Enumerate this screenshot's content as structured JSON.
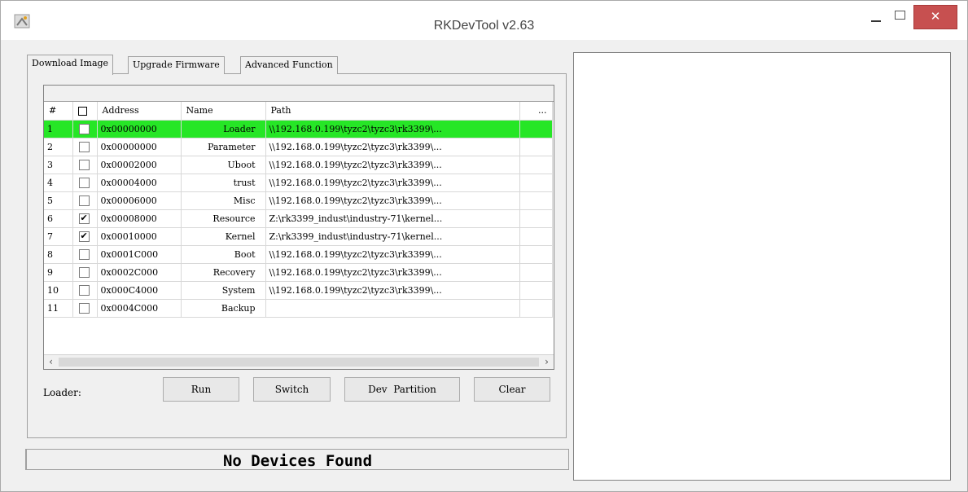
{
  "window": {
    "title": "RKDevTool v2.63"
  },
  "tabs": [
    {
      "label": "Download Image"
    },
    {
      "label": "Upgrade Firmware"
    },
    {
      "label": "Advanced Function"
    }
  ],
  "grid": {
    "headers": {
      "num": "#",
      "address": "Address",
      "name": "Name",
      "path": "Path",
      "more": "..."
    },
    "rows": [
      {
        "num": "1",
        "checked": false,
        "address": "0x00000000",
        "name": "Loader",
        "path": "\\\\192.168.0.199\\tyzc2\\tyzc3\\rk3399\\...",
        "selected": true
      },
      {
        "num": "2",
        "checked": false,
        "address": "0x00000000",
        "name": "Parameter",
        "path": "\\\\192.168.0.199\\tyzc2\\tyzc3\\rk3399\\..."
      },
      {
        "num": "3",
        "checked": false,
        "address": "0x00002000",
        "name": "Uboot",
        "path": "\\\\192.168.0.199\\tyzc2\\tyzc3\\rk3399\\..."
      },
      {
        "num": "4",
        "checked": false,
        "address": "0x00004000",
        "name": "trust",
        "path": "\\\\192.168.0.199\\tyzc2\\tyzc3\\rk3399\\..."
      },
      {
        "num": "5",
        "checked": false,
        "address": "0x00006000",
        "name": "Misc",
        "path": "\\\\192.168.0.199\\tyzc2\\tyzc3\\rk3399\\..."
      },
      {
        "num": "6",
        "checked": true,
        "address": "0x00008000",
        "name": "Resource",
        "path": "Z:\\rk3399_indust\\industry-71\\kernel..."
      },
      {
        "num": "7",
        "checked": true,
        "address": "0x00010000",
        "name": "Kernel",
        "path": "Z:\\rk3399_indust\\industry-71\\kernel..."
      },
      {
        "num": "8",
        "checked": false,
        "address": "0x0001C000",
        "name": "Boot",
        "path": "\\\\192.168.0.199\\tyzc2\\tyzc3\\rk3399\\..."
      },
      {
        "num": "9",
        "checked": false,
        "address": "0x0002C000",
        "name": "Recovery",
        "path": "\\\\192.168.0.199\\tyzc2\\tyzc3\\rk3399\\..."
      },
      {
        "num": "10",
        "checked": false,
        "address": "0x000C4000",
        "name": "System",
        "path": "\\\\192.168.0.199\\tyzc2\\tyzc3\\rk3399\\..."
      },
      {
        "num": "11",
        "checked": false,
        "address": "0x0004C000",
        "name": "Backup",
        "path": ""
      }
    ]
  },
  "loader_label": "Loader:",
  "buttons": {
    "run": "Run",
    "switch": "Switch",
    "dev_partition": "Dev  Partition",
    "clear": "Clear"
  },
  "status": "No Devices Found",
  "colors": {
    "selected_row": "#26e626",
    "close_button": "#c75050"
  },
  "icons": [
    "app-icon",
    "minimize-icon",
    "maximize-icon",
    "close-icon",
    "scroll-left-icon",
    "scroll-right-icon",
    "checkmark-icon"
  ]
}
